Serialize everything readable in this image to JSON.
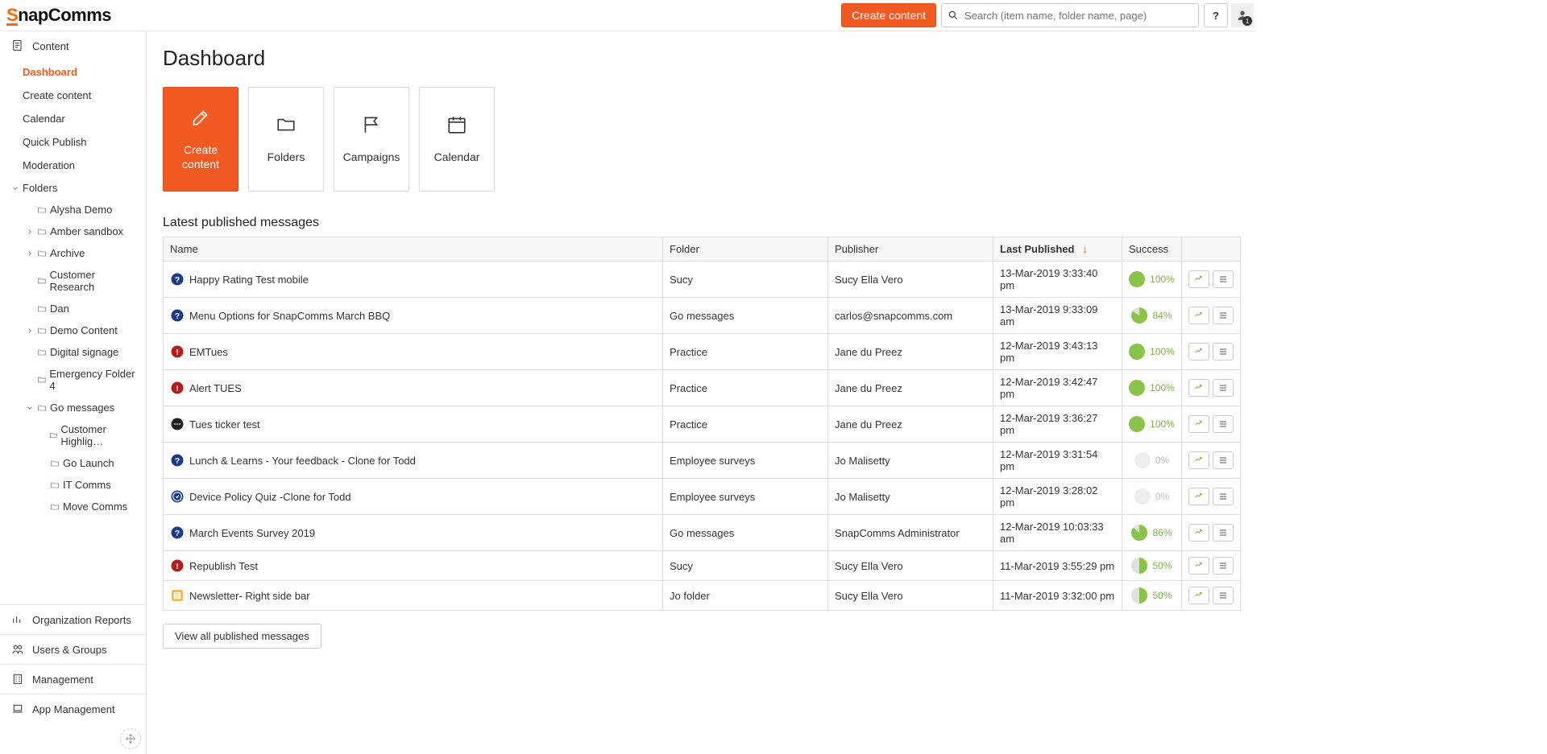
{
  "brand": {
    "first": "S",
    "rest": "napComms"
  },
  "header": {
    "create_content": "Create content",
    "search_placeholder": "Search (item name, folder name, page)",
    "help_label": "?",
    "user_badge": "1"
  },
  "sidebar": {
    "content_label": "Content",
    "nav": [
      {
        "label": "Dashboard",
        "active": true
      },
      {
        "label": "Create content"
      },
      {
        "label": "Calendar"
      },
      {
        "label": "Quick Publish"
      },
      {
        "label": "Moderation"
      }
    ],
    "folders_label": "Folders",
    "folder_tree": [
      {
        "label": "Alysha Demo",
        "indent": 1,
        "expandable": false
      },
      {
        "label": "Amber sandbox",
        "indent": 1,
        "expandable": true
      },
      {
        "label": "Archive",
        "indent": 1,
        "expandable": true
      },
      {
        "label": "Customer Research",
        "indent": 1,
        "expandable": false
      },
      {
        "label": "Dan",
        "indent": 1,
        "expandable": false
      },
      {
        "label": "Demo Content",
        "indent": 1,
        "expandable": true
      },
      {
        "label": "Digital signage",
        "indent": 1,
        "expandable": false
      },
      {
        "label": "Emergency Folder 4",
        "indent": 1,
        "expandable": false
      },
      {
        "label": "Go messages",
        "indent": 1,
        "expandable": true,
        "expanded": true
      },
      {
        "label": "Customer Highlig…",
        "indent": 2,
        "expandable": false
      },
      {
        "label": "Go Launch",
        "indent": 2,
        "expandable": false
      },
      {
        "label": "IT Comms",
        "indent": 2,
        "expandable": false
      },
      {
        "label": "Move Comms",
        "indent": 2,
        "expandable": false
      }
    ],
    "bottom": [
      {
        "label": "Organization Reports",
        "icon": "bars"
      },
      {
        "label": "Users & Groups",
        "icon": "users"
      },
      {
        "label": "Management",
        "icon": "building"
      },
      {
        "label": "App Management",
        "icon": "laptop"
      }
    ]
  },
  "page": {
    "title": "Dashboard",
    "tiles": [
      {
        "label": "Create content",
        "icon": "edit",
        "orange": true
      },
      {
        "label": "Folders",
        "icon": "folder"
      },
      {
        "label": "Campaigns",
        "icon": "flag"
      },
      {
        "label": "Calendar",
        "icon": "calendar"
      }
    ],
    "section_title": "Latest published messages",
    "columns": {
      "name": "Name",
      "folder": "Folder",
      "publisher": "Publisher",
      "last_published": "Last Published",
      "success": "Success"
    },
    "rows": [
      {
        "icon": "question",
        "name": "Happy Rating Test mobile",
        "folder": "Sucy",
        "publisher": "Sucy Ella Vero",
        "last_published": "13-Mar-2019 3:33:40 pm",
        "success": 100
      },
      {
        "icon": "question",
        "name": "Menu Options for SnapComms March BBQ",
        "folder": "Go messages",
        "publisher": "carlos@snapcomms.com",
        "last_published": "13-Mar-2019 9:33:09 am",
        "success": 84
      },
      {
        "icon": "alert",
        "name": "EMTues",
        "folder": "Practice",
        "publisher": "Jane du Preez",
        "last_published": "12-Mar-2019 3:43:13 pm",
        "success": 100
      },
      {
        "icon": "alert",
        "name": "Alert TUES",
        "folder": "Practice",
        "publisher": "Jane du Preez",
        "last_published": "12-Mar-2019 3:42:47 pm",
        "success": 100
      },
      {
        "icon": "ticker",
        "name": "Tues ticker test",
        "folder": "Practice",
        "publisher": "Jane du Preez",
        "last_published": "12-Mar-2019 3:36:27 pm",
        "success": 100
      },
      {
        "icon": "question",
        "name": "Lunch & Learns - Your feedback - Clone for Todd",
        "folder": "Employee surveys",
        "publisher": "Jo Malisetty",
        "last_published": "12-Mar-2019 3:31:54 pm",
        "success": 0
      },
      {
        "icon": "quiz",
        "name": "Device Policy Quiz -Clone for Todd",
        "folder": "Employee surveys",
        "publisher": "Jo Malisetty",
        "last_published": "12-Mar-2019 3:28:02 pm",
        "success": 0
      },
      {
        "icon": "question",
        "name": "March Events Survey 2019",
        "folder": "Go messages",
        "publisher": "SnapComms Administrator",
        "last_published": "12-Mar-2019 10:03:33 am",
        "success": 86
      },
      {
        "icon": "alert",
        "name": "Republish Test",
        "folder": "Sucy",
        "publisher": "Sucy Ella Vero",
        "last_published": "11-Mar-2019 3:55:29 pm",
        "success": 50
      },
      {
        "icon": "newsletter",
        "name": "Newsletter- Right side bar",
        "folder": "Jo folder",
        "publisher": "Sucy Ella Vero",
        "last_published": "11-Mar-2019 3:32:00 pm",
        "success": 50
      }
    ],
    "view_all": "View all published messages"
  },
  "colors": {
    "orange": "#f15a22",
    "green": "#8bc34a"
  }
}
